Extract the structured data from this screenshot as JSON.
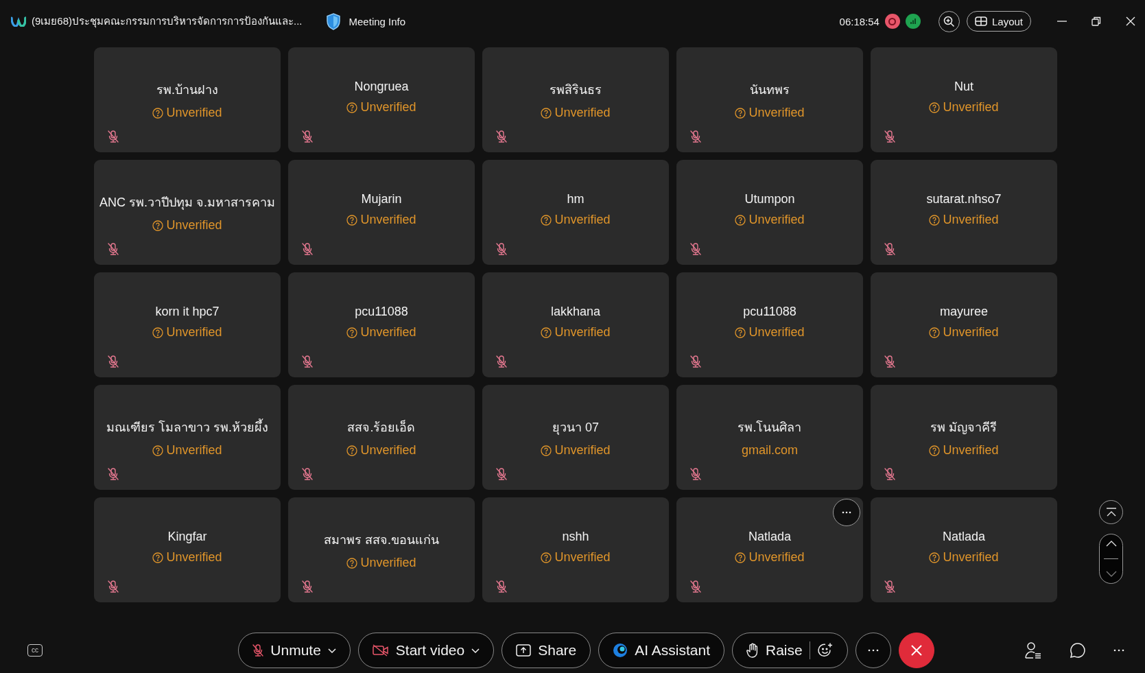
{
  "window": {
    "title": "(9เมย68)ประชุมคณะกรรมการบริหารจัดการการป้องกันและ...",
    "meeting_info": "Meeting Info",
    "elapsed": "06:18:54",
    "recording": true,
    "layout_button": "Layout"
  },
  "participants": [
    {
      "name": "รพ.บ้านฝาง",
      "status": "Unverified",
      "kind": "unverified",
      "muted": true,
      "more_button": false
    },
    {
      "name": "Nongruea",
      "status": "Unverified",
      "kind": "unverified",
      "muted": true,
      "more_button": false
    },
    {
      "name": "รพสิรินธร",
      "status": "Unverified",
      "kind": "unverified",
      "muted": true,
      "more_button": false
    },
    {
      "name": "นันทพร",
      "status": "Unverified",
      "kind": "unverified",
      "muted": true,
      "more_button": false
    },
    {
      "name": "Nut",
      "status": "Unverified",
      "kind": "unverified",
      "muted": true,
      "more_button": false
    },
    {
      "name": "ANC รพ.วาปีปทุม จ.มหาสารคาม",
      "status": "Unverified",
      "kind": "unverified",
      "muted": true,
      "more_button": false
    },
    {
      "name": "Mujarin",
      "status": "Unverified",
      "kind": "unverified",
      "muted": true,
      "more_button": false
    },
    {
      "name": "hm",
      "status": "Unverified",
      "kind": "unverified",
      "muted": true,
      "more_button": false
    },
    {
      "name": "Utumpon",
      "status": "Unverified",
      "kind": "unverified",
      "muted": true,
      "more_button": false
    },
    {
      "name": "sutarat.nhso7",
      "status": "Unverified",
      "kind": "unverified",
      "muted": true,
      "more_button": false
    },
    {
      "name": "korn it hpc7",
      "status": "Unverified",
      "kind": "unverified",
      "muted": true,
      "more_button": false
    },
    {
      "name": "pcu11088",
      "status": "Unverified",
      "kind": "unverified",
      "muted": true,
      "more_button": false
    },
    {
      "name": "lakkhana",
      "status": "Unverified",
      "kind": "unverified",
      "muted": true,
      "more_button": false
    },
    {
      "name": "pcu11088",
      "status": "Unverified",
      "kind": "unverified",
      "muted": true,
      "more_button": false
    },
    {
      "name": "mayuree",
      "status": "Unverified",
      "kind": "unverified",
      "muted": true,
      "more_button": false
    },
    {
      "name": "มณเฑียร โมลาขาว รพ.ห้วยผึ้ง",
      "status": "Unverified",
      "kind": "unverified",
      "muted": true,
      "more_button": false
    },
    {
      "name": "สสจ.ร้อยเอ็ด",
      "status": "Unverified",
      "kind": "unverified",
      "muted": true,
      "more_button": false
    },
    {
      "name": "ยุวนา 07",
      "status": "Unverified",
      "kind": "unverified",
      "muted": true,
      "more_button": false
    },
    {
      "name": "รพ.โนนศิลา",
      "status": "gmail.com",
      "kind": "domain",
      "muted": true,
      "more_button": false
    },
    {
      "name": "รพ มัญจาคีรี",
      "status": "Unverified",
      "kind": "unverified",
      "muted": true,
      "more_button": false
    },
    {
      "name": "Kingfar",
      "status": "Unverified",
      "kind": "unverified",
      "muted": true,
      "more_button": false
    },
    {
      "name": "สมาพร สสจ.ขอนแก่น",
      "status": "Unverified",
      "kind": "unverified",
      "muted": true,
      "more_button": false
    },
    {
      "name": "nshh",
      "status": "Unverified",
      "kind": "unverified",
      "muted": true,
      "more_button": false
    },
    {
      "name": "Natlada",
      "status": "Unverified",
      "kind": "unverified",
      "muted": true,
      "more_button": true
    },
    {
      "name": "Natlada",
      "status": "Unverified",
      "kind": "unverified",
      "muted": true,
      "more_button": false
    }
  ],
  "controls": {
    "captions": "cc",
    "unmute": "Unmute",
    "start_video": "Start video",
    "share": "Share",
    "ai_assistant": "AI Assistant",
    "raise": "Raise"
  }
}
